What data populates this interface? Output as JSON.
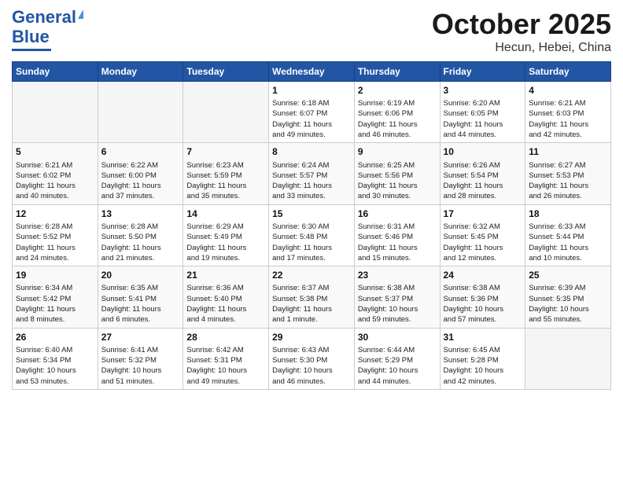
{
  "header": {
    "logo_line1": "General",
    "logo_line2": "Blue",
    "month": "October 2025",
    "location": "Hecun, Hebei, China"
  },
  "weekdays": [
    "Sunday",
    "Monday",
    "Tuesday",
    "Wednesday",
    "Thursday",
    "Friday",
    "Saturday"
  ],
  "weeks": [
    [
      {
        "day": "",
        "info": ""
      },
      {
        "day": "",
        "info": ""
      },
      {
        "day": "",
        "info": ""
      },
      {
        "day": "1",
        "info": "Sunrise: 6:18 AM\nSunset: 6:07 PM\nDaylight: 11 hours\nand 49 minutes."
      },
      {
        "day": "2",
        "info": "Sunrise: 6:19 AM\nSunset: 6:06 PM\nDaylight: 11 hours\nand 46 minutes."
      },
      {
        "day": "3",
        "info": "Sunrise: 6:20 AM\nSunset: 6:05 PM\nDaylight: 11 hours\nand 44 minutes."
      },
      {
        "day": "4",
        "info": "Sunrise: 6:21 AM\nSunset: 6:03 PM\nDaylight: 11 hours\nand 42 minutes."
      }
    ],
    [
      {
        "day": "5",
        "info": "Sunrise: 6:21 AM\nSunset: 6:02 PM\nDaylight: 11 hours\nand 40 minutes."
      },
      {
        "day": "6",
        "info": "Sunrise: 6:22 AM\nSunset: 6:00 PM\nDaylight: 11 hours\nand 37 minutes."
      },
      {
        "day": "7",
        "info": "Sunrise: 6:23 AM\nSunset: 5:59 PM\nDaylight: 11 hours\nand 35 minutes."
      },
      {
        "day": "8",
        "info": "Sunrise: 6:24 AM\nSunset: 5:57 PM\nDaylight: 11 hours\nand 33 minutes."
      },
      {
        "day": "9",
        "info": "Sunrise: 6:25 AM\nSunset: 5:56 PM\nDaylight: 11 hours\nand 30 minutes."
      },
      {
        "day": "10",
        "info": "Sunrise: 6:26 AM\nSunset: 5:54 PM\nDaylight: 11 hours\nand 28 minutes."
      },
      {
        "day": "11",
        "info": "Sunrise: 6:27 AM\nSunset: 5:53 PM\nDaylight: 11 hours\nand 26 minutes."
      }
    ],
    [
      {
        "day": "12",
        "info": "Sunrise: 6:28 AM\nSunset: 5:52 PM\nDaylight: 11 hours\nand 24 minutes."
      },
      {
        "day": "13",
        "info": "Sunrise: 6:28 AM\nSunset: 5:50 PM\nDaylight: 11 hours\nand 21 minutes."
      },
      {
        "day": "14",
        "info": "Sunrise: 6:29 AM\nSunset: 5:49 PM\nDaylight: 11 hours\nand 19 minutes."
      },
      {
        "day": "15",
        "info": "Sunrise: 6:30 AM\nSunset: 5:48 PM\nDaylight: 11 hours\nand 17 minutes."
      },
      {
        "day": "16",
        "info": "Sunrise: 6:31 AM\nSunset: 5:46 PM\nDaylight: 11 hours\nand 15 minutes."
      },
      {
        "day": "17",
        "info": "Sunrise: 6:32 AM\nSunset: 5:45 PM\nDaylight: 11 hours\nand 12 minutes."
      },
      {
        "day": "18",
        "info": "Sunrise: 6:33 AM\nSunset: 5:44 PM\nDaylight: 11 hours\nand 10 minutes."
      }
    ],
    [
      {
        "day": "19",
        "info": "Sunrise: 6:34 AM\nSunset: 5:42 PM\nDaylight: 11 hours\nand 8 minutes."
      },
      {
        "day": "20",
        "info": "Sunrise: 6:35 AM\nSunset: 5:41 PM\nDaylight: 11 hours\nand 6 minutes."
      },
      {
        "day": "21",
        "info": "Sunrise: 6:36 AM\nSunset: 5:40 PM\nDaylight: 11 hours\nand 4 minutes."
      },
      {
        "day": "22",
        "info": "Sunrise: 6:37 AM\nSunset: 5:38 PM\nDaylight: 11 hours\nand 1 minute."
      },
      {
        "day": "23",
        "info": "Sunrise: 6:38 AM\nSunset: 5:37 PM\nDaylight: 10 hours\nand 59 minutes."
      },
      {
        "day": "24",
        "info": "Sunrise: 6:38 AM\nSunset: 5:36 PM\nDaylight: 10 hours\nand 57 minutes."
      },
      {
        "day": "25",
        "info": "Sunrise: 6:39 AM\nSunset: 5:35 PM\nDaylight: 10 hours\nand 55 minutes."
      }
    ],
    [
      {
        "day": "26",
        "info": "Sunrise: 6:40 AM\nSunset: 5:34 PM\nDaylight: 10 hours\nand 53 minutes."
      },
      {
        "day": "27",
        "info": "Sunrise: 6:41 AM\nSunset: 5:32 PM\nDaylight: 10 hours\nand 51 minutes."
      },
      {
        "day": "28",
        "info": "Sunrise: 6:42 AM\nSunset: 5:31 PM\nDaylight: 10 hours\nand 49 minutes."
      },
      {
        "day": "29",
        "info": "Sunrise: 6:43 AM\nSunset: 5:30 PM\nDaylight: 10 hours\nand 46 minutes."
      },
      {
        "day": "30",
        "info": "Sunrise: 6:44 AM\nSunset: 5:29 PM\nDaylight: 10 hours\nand 44 minutes."
      },
      {
        "day": "31",
        "info": "Sunrise: 6:45 AM\nSunset: 5:28 PM\nDaylight: 10 hours\nand 42 minutes."
      },
      {
        "day": "",
        "info": ""
      }
    ]
  ]
}
